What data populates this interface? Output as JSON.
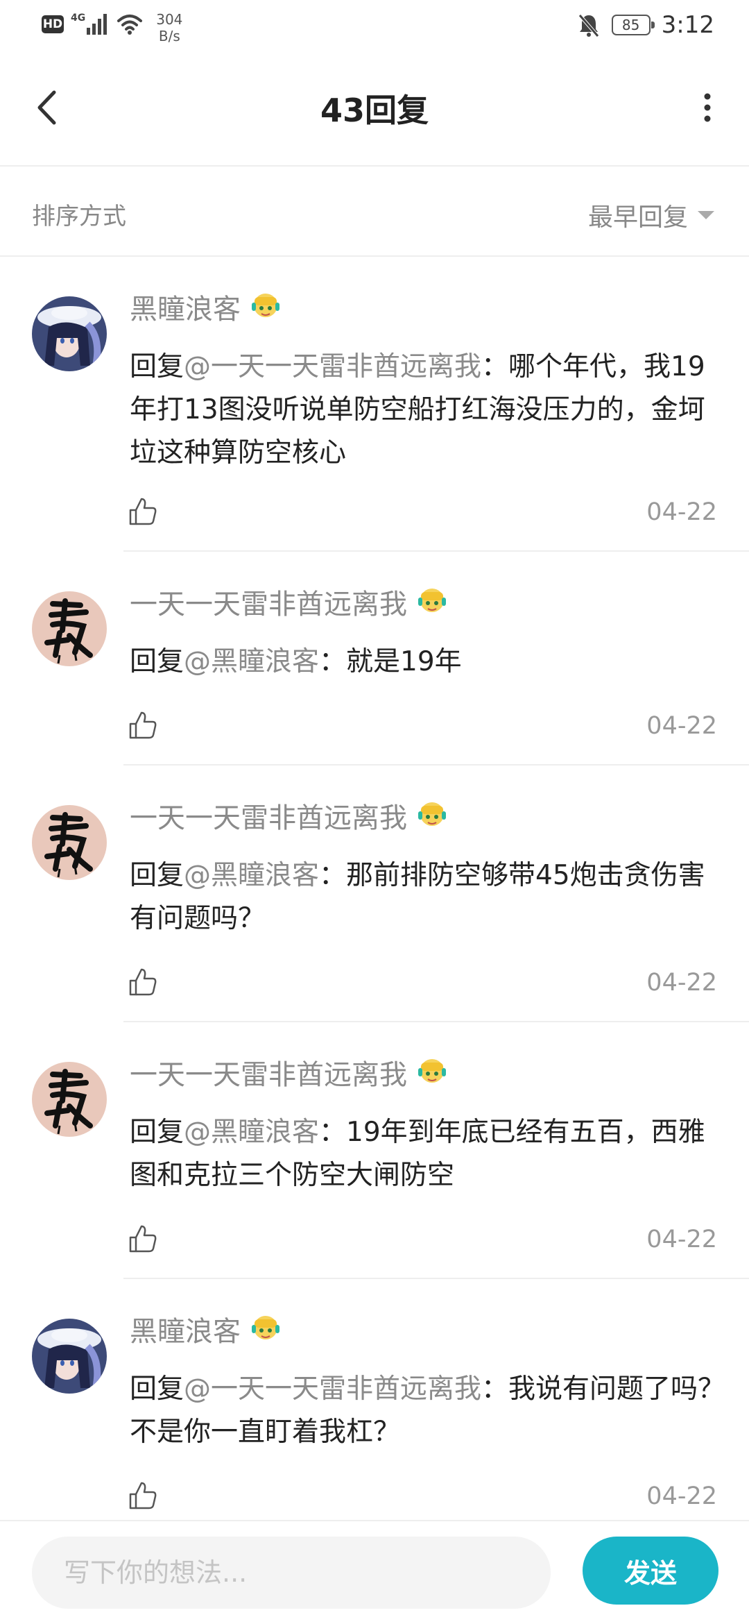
{
  "status_bar": {
    "hd": "HD",
    "network": "4G",
    "speed_value": "304",
    "speed_unit": "B/s",
    "battery": "85",
    "time": "3:12"
  },
  "header": {
    "title": "43回复"
  },
  "sort": {
    "label": "排序方式",
    "selected": "最早回复"
  },
  "comments": [
    {
      "author": "黑瞳浪客",
      "avatar": "anime-girl-avatar",
      "reply_prefix": "回复",
      "mention": "@一天一天雷非酋远离我",
      "text": "：哪个年代，我19年打13图没听说单防空船打红海没压力的，金坷垃这种算防空核心",
      "date": "04-22"
    },
    {
      "author": "一天一天雷非酋远离我",
      "avatar": "calligraphy-avatar",
      "reply_prefix": "回复",
      "mention": "@黑瞳浪客",
      "text": "：就是19年",
      "date": "04-22"
    },
    {
      "author": "一天一天雷非酋远离我",
      "avatar": "calligraphy-avatar",
      "reply_prefix": "回复",
      "mention": "@黑瞳浪客",
      "text": "：那前排防空够带45炮击贪伤害有问题吗？",
      "date": "04-22"
    },
    {
      "author": "一天一天雷非酋远离我",
      "avatar": "calligraphy-avatar",
      "reply_prefix": "回复",
      "mention": "@黑瞳浪客",
      "text": "：19年到年底已经有五百，西雅图和克拉三个防空大闸防空",
      "date": "04-22"
    },
    {
      "author": "黑瞳浪客",
      "avatar": "anime-girl-avatar",
      "reply_prefix": "回复",
      "mention": "@一天一天雷非酋远离我",
      "text": "：我说有问题了吗？不是你一直盯着我杠？",
      "date": "04-22"
    }
  ],
  "composer": {
    "placeholder": "写下你的想法...",
    "send_label": "发送"
  },
  "colors": {
    "accent": "#1ab5c8",
    "muted_text": "#8a8a8a"
  }
}
